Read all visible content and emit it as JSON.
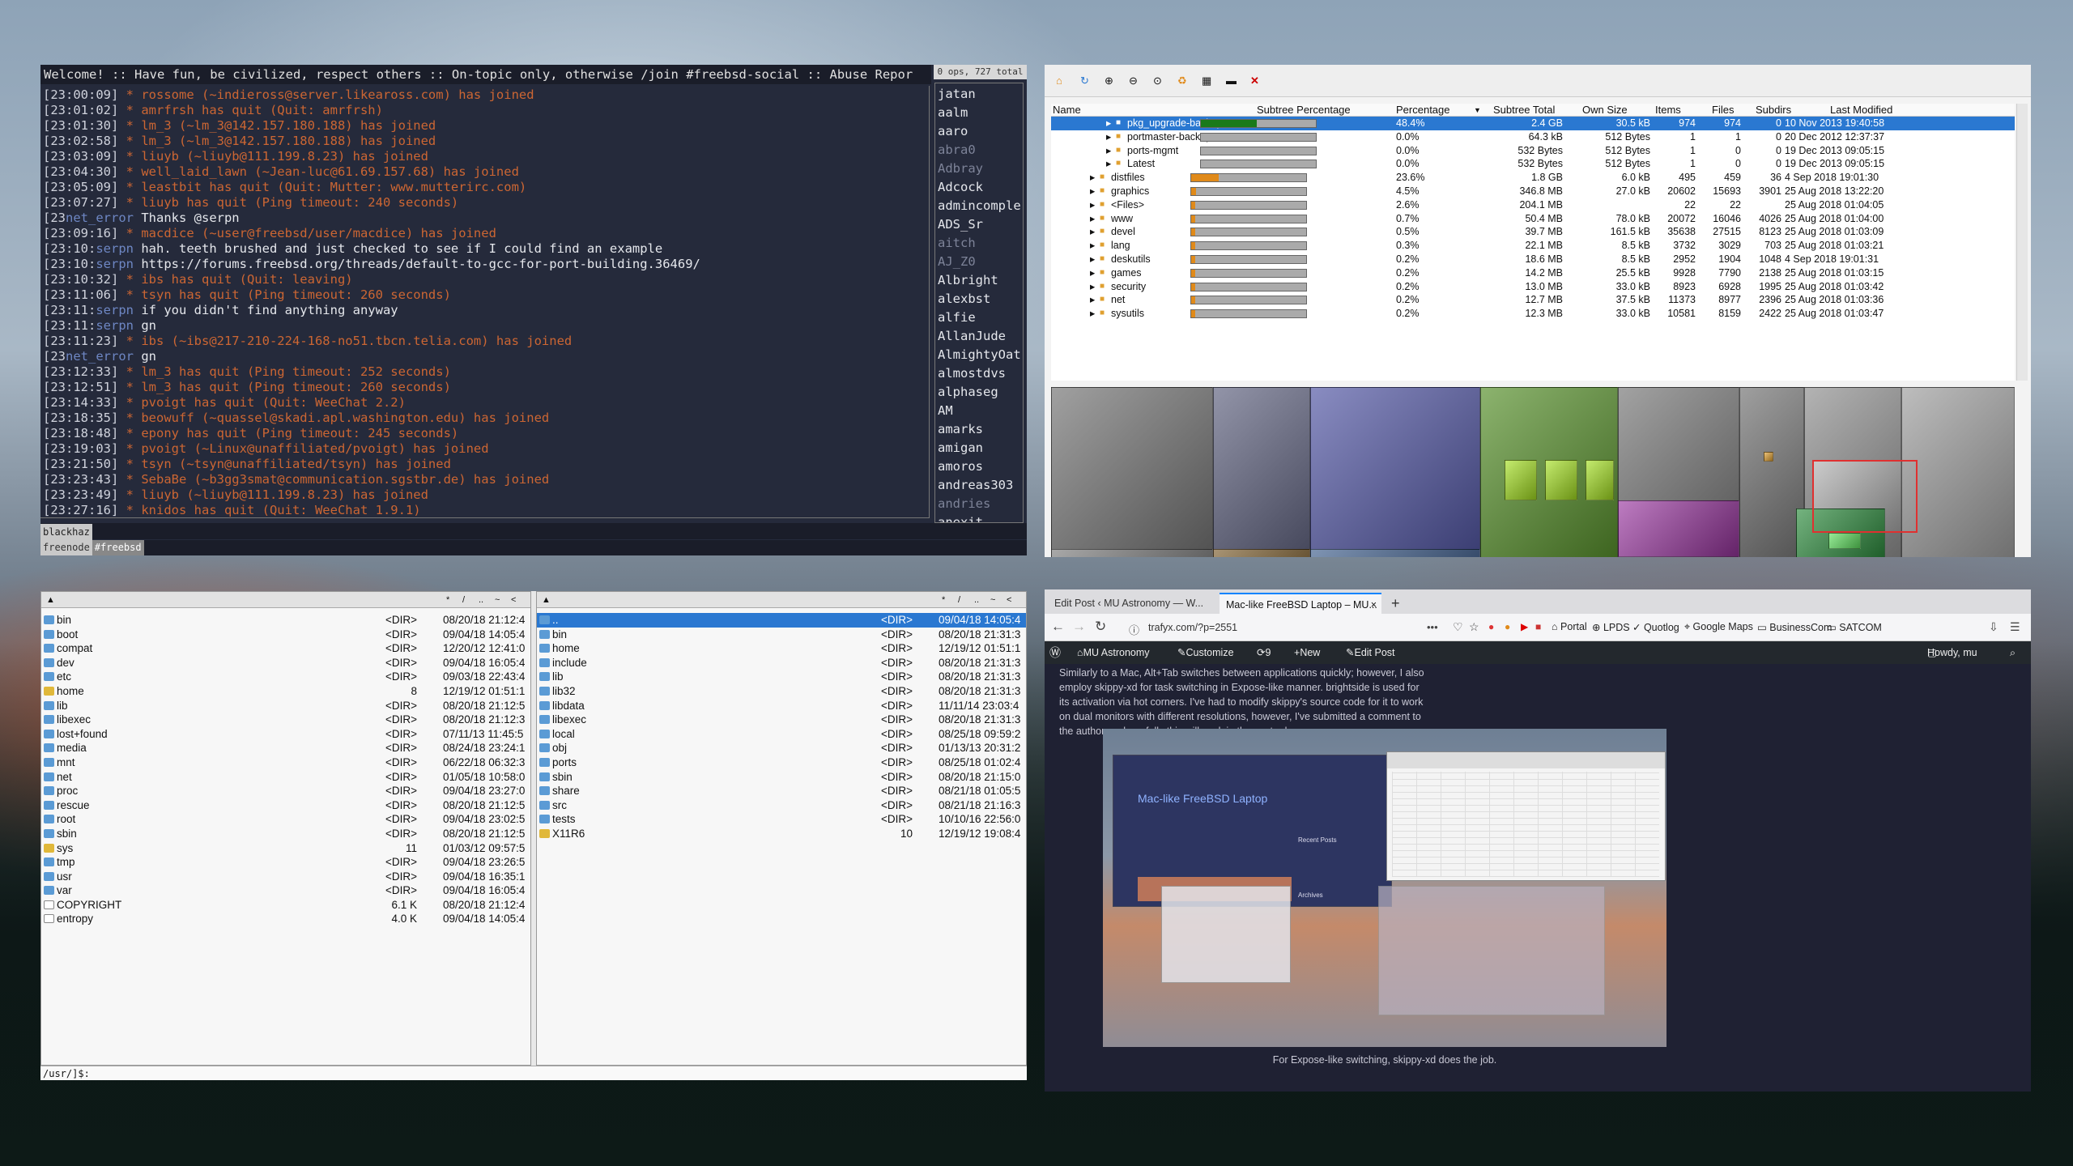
{
  "irc": {
    "topic": "Welcome! :: Have fun, be civilized, respect others :: On-topic only, otherwise /join #freebsd-social :: Abuse Repor",
    "ops_info": "0 ops, 727 total",
    "lines": [
      {
        "ts": "[23:00:09]",
        "sym": " * ",
        "text": "rossome (~indieross@server.likeaross.com) has joined",
        "kind": "ev"
      },
      {
        "ts": "[23:01:02]",
        "sym": " * ",
        "text": "amrfrsh has quit (Quit: amrfrsh)",
        "kind": "ev"
      },
      {
        "ts": "[23:01:30]",
        "sym": " * ",
        "text": "lm_3 (~lm_3@142.157.180.188) has joined",
        "kind": "ev"
      },
      {
        "ts": "[23:02:58]",
        "sym": " * ",
        "text": "lm_3  (~lm_3@142.157.180.188) has joined",
        "kind": "ev"
      },
      {
        "ts": "[23:03:09]",
        "sym": " * ",
        "text": "liuyb (~liuyb@111.199.8.23) has joined",
        "kind": "ev"
      },
      {
        "ts": "[23:04:30]",
        "sym": " * ",
        "text": "well_laid_lawn (~Jean-luc@61.69.157.68) has joined",
        "kind": "ev"
      },
      {
        "ts": "[23:05:09]",
        "sym": " * ",
        "text": "leastbit has quit (Quit: Mutter: www.mutterirc.com)",
        "kind": "ev"
      },
      {
        "ts": "[23:07:27]",
        "sym": " * ",
        "text": "liuyb has quit (Ping timeout: 240 seconds)",
        "kind": "ev"
      },
      {
        "ts": "[23",
        "sym": "net_error ",
        "text": "Thanks @serpn",
        "kind": "tx"
      },
      {
        "ts": "[23:09:16]",
        "sym": " * ",
        "text": "macdice (~user@freebsd/user/macdice) has joined",
        "kind": "ev"
      },
      {
        "ts": "[23:10:",
        "sym": "serpn ",
        "text": "hah. teeth brushed and just checked to see if I could find an example",
        "kind": "tx"
      },
      {
        "ts": "[23:10:",
        "sym": "serpn ",
        "text": "https://forums.freebsd.org/threads/default-to-gcc-for-port-building.36469/",
        "kind": "tx"
      },
      {
        "ts": "[23:10:32]",
        "sym": " * ",
        "text": "ibs has quit (Quit: leaving)",
        "kind": "ev"
      },
      {
        "ts": "[23:11:06]",
        "sym": " * ",
        "text": "tsyn has quit (Ping timeout: 260 seconds)",
        "kind": "ev"
      },
      {
        "ts": "[23:11:",
        "sym": "serpn ",
        "text": "if you didn't find anything anyway",
        "kind": "tx"
      },
      {
        "ts": "[23:11:",
        "sym": "serpn ",
        "text": "gn",
        "kind": "tx"
      },
      {
        "ts": "[23:11:23]",
        "sym": " * ",
        "text": "ibs (~ibs@217-210-224-168-no51.tbcn.telia.com) has joined",
        "kind": "ev"
      },
      {
        "ts": "[23",
        "sym": "net_error ",
        "text": "gn",
        "kind": "tx"
      },
      {
        "ts": "[23:12:33]",
        "sym": " * ",
        "text": "lm_3  has quit (Ping timeout: 252 seconds)",
        "kind": "ev"
      },
      {
        "ts": "[23:12:51]",
        "sym": " * ",
        "text": "lm_3 has quit (Ping timeout: 260 seconds)",
        "kind": "ev"
      },
      {
        "ts": "[23:14:33]",
        "sym": " * ",
        "text": "pvoigt has quit (Quit: WeeChat 2.2)",
        "kind": "ev"
      },
      {
        "ts": "[23:18:35]",
        "sym": " * ",
        "text": "beowuff (~quassel@skadi.apl.washington.edu) has joined",
        "kind": "ev"
      },
      {
        "ts": "[23:18:48]",
        "sym": " * ",
        "text": "epony has quit (Ping timeout: 245 seconds)",
        "kind": "ev"
      },
      {
        "ts": "[23:19:03]",
        "sym": " * ",
        "text": "pvoigt (~Linux@unaffiliated/pvoigt) has joined",
        "kind": "ev"
      },
      {
        "ts": "[23:21:50]",
        "sym": " * ",
        "text": "tsyn (~tsyn@unaffiliated/tsyn) has joined",
        "kind": "ev"
      },
      {
        "ts": "[23:23:43]",
        "sym": " * ",
        "text": "SebaBe (~b3gg3smat@communication.sgstbr.de) has joined",
        "kind": "ev"
      },
      {
        "ts": "[23:23:49]",
        "sym": " * ",
        "text": "liuyb (~liuyb@111.199.8.23) has joined",
        "kind": "ev"
      },
      {
        "ts": "[23:27:16]",
        "sym": " * ",
        "text": "knidos has quit (Quit: WeeChat 1.9.1)",
        "kind": "ev"
      }
    ],
    "nicks": [
      {
        "n": " jatan",
        "away": false
      },
      {
        "n": "aalm",
        "away": false
      },
      {
        "n": "aaro",
        "away": false
      },
      {
        "n": "abra0",
        "away": true
      },
      {
        "n": "Adbray",
        "away": true
      },
      {
        "n": "Adcock",
        "away": false
      },
      {
        "n": "admincomple",
        "away": false
      },
      {
        "n": "ADS_Sr",
        "away": false
      },
      {
        "n": "aitch",
        "away": true
      },
      {
        "n": "AJ_Z0",
        "away": true
      },
      {
        "n": "Albright",
        "away": false
      },
      {
        "n": "alexbst",
        "away": false
      },
      {
        "n": "alfie",
        "away": false
      },
      {
        "n": "AllanJude",
        "away": false
      },
      {
        "n": "AlmightyOat",
        "away": false
      },
      {
        "n": "almostdvs",
        "away": false
      },
      {
        "n": "alphaseg",
        "away": false
      },
      {
        "n": "AM",
        "away": false
      },
      {
        "n": "amarks",
        "away": false
      },
      {
        "n": "amigan",
        "away": false
      },
      {
        "n": "amoros",
        "away": false
      },
      {
        "n": "andreas303",
        "away": false
      },
      {
        "n": "andries",
        "away": true
      },
      {
        "n": "anexit",
        "away": false
      }
    ],
    "input_nick": "blackhaz",
    "status": [
      "freenode",
      "#freebsd"
    ]
  },
  "disk": {
    "toolbar_icons": [
      "home-icon",
      "refresh-icon",
      "zoom-in-icon",
      "zoom-out-icon",
      "zoom-fit-icon",
      "delete-icon",
      "grid-icon",
      "terminal-icon",
      "close-icon"
    ],
    "columns": [
      "Name",
      "Subtree Percentage",
      "Percentage",
      "Subtree Total",
      "Own Size",
      "Items",
      "Files",
      "Subdirs",
      "Last Modified"
    ],
    "rows": [
      {
        "indent": 3,
        "name": "pkg_upgrade-backup",
        "pct": "48.4%",
        "fill": 0.484,
        "color": "#1a7a1a",
        "total": "2.4 GB",
        "own": "30.5 kB",
        "items": "974",
        "files": "974",
        "subdirs": "0",
        "mod": "10 Nov 2013 19:40:58",
        "sel": true
      },
      {
        "indent": 3,
        "name": "portmaster-backup",
        "pct": "0.0%",
        "fill": 0.0,
        "color": "#1a7a1a",
        "total": "64.3 kB",
        "own": "512 Bytes",
        "items": "1",
        "files": "1",
        "subdirs": "0",
        "mod": "20 Dec 2012 12:37:37",
        "sel": false
      },
      {
        "indent": 3,
        "name": "ports-mgmt",
        "pct": "0.0%",
        "fill": 0.0,
        "color": "#1a7a1a",
        "total": "532 Bytes",
        "own": "512 Bytes",
        "items": "1",
        "files": "0",
        "subdirs": "0",
        "mod": "19 Dec 2013 09:05:15",
        "sel": false
      },
      {
        "indent": 3,
        "name": "Latest",
        "pct": "0.0%",
        "fill": 0.0,
        "color": "#1a7a1a",
        "total": "532 Bytes",
        "own": "512 Bytes",
        "items": "1",
        "files": "0",
        "subdirs": "0",
        "mod": "19 Dec 2013 09:05:15",
        "sel": false
      },
      {
        "indent": 2,
        "name": "distfiles",
        "pct": "23.6%",
        "fill": 0.236,
        "color": "#e08a1a",
        "total": "1.8 GB",
        "own": "6.0 kB",
        "items": "495",
        "files": "459",
        "subdirs": "36",
        "mod": "4 Sep 2018 19:01:30",
        "sel": false
      },
      {
        "indent": 2,
        "name": "graphics",
        "pct": "4.5%",
        "fill": 0.045,
        "color": "#e08a1a",
        "total": "346.8 MB",
        "own": "27.0 kB",
        "items": "20602",
        "files": "15693",
        "subdirs": "3901",
        "mod": "25 Aug 2018 13:22:20",
        "sel": false
      },
      {
        "indent": 2,
        "name": "<Files>",
        "pct": "2.6%",
        "fill": 0.026,
        "color": "#e08a1a",
        "total": "204.1 MB",
        "own": "",
        "items": "22",
        "files": "22",
        "subdirs": "",
        "mod": "25 Aug 2018 01:04:05",
        "sel": false
      },
      {
        "indent": 2,
        "name": "www",
        "pct": "0.7%",
        "fill": 0.007,
        "color": "#e08a1a",
        "total": "50.4 MB",
        "own": "78.0 kB",
        "items": "20072",
        "files": "16046",
        "subdirs": "4026",
        "mod": "25 Aug 2018 01:04:00",
        "sel": false
      },
      {
        "indent": 2,
        "name": "devel",
        "pct": "0.5%",
        "fill": 0.005,
        "color": "#e08a1a",
        "total": "39.7 MB",
        "own": "161.5 kB",
        "items": "35638",
        "files": "27515",
        "subdirs": "8123",
        "mod": "25 Aug 2018 01:03:09",
        "sel": false
      },
      {
        "indent": 2,
        "name": "lang",
        "pct": "0.3%",
        "fill": 0.003,
        "color": "#e08a1a",
        "total": "22.1 MB",
        "own": "8.5 kB",
        "items": "3732",
        "files": "3029",
        "subdirs": "703",
        "mod": "25 Aug 2018 01:03:21",
        "sel": false
      },
      {
        "indent": 2,
        "name": "deskutils",
        "pct": "0.2%",
        "fill": 0.002,
        "color": "#e08a1a",
        "total": "18.6 MB",
        "own": "8.5 kB",
        "items": "2952",
        "files": "1904",
        "subdirs": "1048",
        "mod": "4 Sep 2018 19:01:31",
        "sel": false
      },
      {
        "indent": 2,
        "name": "games",
        "pct": "0.2%",
        "fill": 0.002,
        "color": "#e08a1a",
        "total": "14.2 MB",
        "own": "25.5 kB",
        "items": "9928",
        "files": "7790",
        "subdirs": "2138",
        "mod": "25 Aug 2018 01:03:15",
        "sel": false
      },
      {
        "indent": 2,
        "name": "security",
        "pct": "0.2%",
        "fill": 0.002,
        "color": "#e08a1a",
        "total": "13.0 MB",
        "own": "33.0 kB",
        "items": "8923",
        "files": "6928",
        "subdirs": "1995",
        "mod": "25 Aug 2018 01:03:42",
        "sel": false
      },
      {
        "indent": 2,
        "name": "net",
        "pct": "0.2%",
        "fill": 0.002,
        "color": "#e08a1a",
        "total": "12.7 MB",
        "own": "37.5 kB",
        "items": "11373",
        "files": "8977",
        "subdirs": "2396",
        "mod": "25 Aug 2018 01:03:36",
        "sel": false
      },
      {
        "indent": 2,
        "name": "sysutils",
        "pct": "0.2%",
        "fill": 0.002,
        "color": "#e08a1a",
        "total": "12.3 MB",
        "own": "33.0 kB",
        "items": "10581",
        "files": "8159",
        "subdirs": "2422",
        "mod": "25 Aug 2018 01:03:47",
        "sel": false
      }
    ]
  },
  "fm": {
    "left_header": [
      "▲",
      "*",
      "/",
      "..",
      "~",
      "<"
    ],
    "right_header": [
      "▲",
      "*",
      "/",
      "..",
      "~",
      "<"
    ],
    "left": [
      {
        "n": "bin",
        "s": "<DIR>",
        "d": "08/20/18 21:12:4",
        "t": "d"
      },
      {
        "n": "boot",
        "s": "<DIR>",
        "d": "09/04/18 14:05:4",
        "t": "d"
      },
      {
        "n": "compat",
        "s": "<DIR>",
        "d": "12/20/12 12:41:0",
        "t": "d"
      },
      {
        "n": "dev",
        "s": "<DIR>",
        "d": "09/04/18 16:05:4",
        "t": "d"
      },
      {
        "n": "etc",
        "s": "<DIR>",
        "d": "09/03/18 22:43:4",
        "t": "d"
      },
      {
        "n": "home",
        "s": "8",
        "d": "12/19/12 01:51:1",
        "t": "y"
      },
      {
        "n": "lib",
        "s": "<DIR>",
        "d": "08/20/18 21:12:5",
        "t": "d"
      },
      {
        "n": "libexec",
        "s": "<DIR>",
        "d": "08/20/18 21:12:3",
        "t": "d"
      },
      {
        "n": "lost+found",
        "s": "<DIR>",
        "d": "07/11/13 11:45:5",
        "t": "d"
      },
      {
        "n": "media",
        "s": "<DIR>",
        "d": "08/24/18 23:24:1",
        "t": "d"
      },
      {
        "n": "mnt",
        "s": "<DIR>",
        "d": "06/22/18 06:32:3",
        "t": "d"
      },
      {
        "n": "net",
        "s": "<DIR>",
        "d": "01/05/18 10:58:0",
        "t": "d"
      },
      {
        "n": "proc",
        "s": "<DIR>",
        "d": "09/04/18 23:27:0",
        "t": "d"
      },
      {
        "n": "rescue",
        "s": "<DIR>",
        "d": "08/20/18 21:12:5",
        "t": "d"
      },
      {
        "n": "root",
        "s": "<DIR>",
        "d": "09/04/18 23:02:5",
        "t": "d"
      },
      {
        "n": "sbin",
        "s": "<DIR>",
        "d": "08/20/18 21:12:5",
        "t": "d"
      },
      {
        "n": "sys",
        "s": "11",
        "d": "01/03/12 09:57:5",
        "t": "y"
      },
      {
        "n": "tmp",
        "s": "<DIR>",
        "d": "09/04/18 23:26:5",
        "t": "d"
      },
      {
        "n": "usr",
        "s": "<DIR>",
        "d": "09/04/18 16:35:1",
        "t": "d"
      },
      {
        "n": "var",
        "s": "<DIR>",
        "d": "09/04/18 16:05:4",
        "t": "d"
      },
      {
        "n": "COPYRIGHT",
        "s": "6.1 K",
        "d": "08/20/18 21:12:4",
        "t": "f"
      },
      {
        "n": "entropy",
        "s": "4.0 K",
        "d": "09/04/18 14:05:4",
        "t": "f"
      }
    ],
    "right": [
      {
        "n": "..",
        "s": "<DIR>",
        "d": "09/04/18 14:05:4",
        "t": "d",
        "sel": true
      },
      {
        "n": "bin",
        "s": "<DIR>",
        "d": "08/20/18 21:31:3",
        "t": "d"
      },
      {
        "n": "home",
        "s": "<DIR>",
        "d": "12/19/12 01:51:1",
        "t": "d"
      },
      {
        "n": "include",
        "s": "<DIR>",
        "d": "08/20/18 21:31:3",
        "t": "d"
      },
      {
        "n": "lib",
        "s": "<DIR>",
        "d": "08/20/18 21:31:3",
        "t": "d"
      },
      {
        "n": "lib32",
        "s": "<DIR>",
        "d": "08/20/18 21:31:3",
        "t": "d"
      },
      {
        "n": "libdata",
        "s": "<DIR>",
        "d": "11/11/14 23:03:4",
        "t": "d"
      },
      {
        "n": "libexec",
        "s": "<DIR>",
        "d": "08/20/18 21:31:3",
        "t": "d"
      },
      {
        "n": "local",
        "s": "<DIR>",
        "d": "08/25/18 09:59:2",
        "t": "d"
      },
      {
        "n": "obj",
        "s": "<DIR>",
        "d": "01/13/13 20:31:2",
        "t": "d"
      },
      {
        "n": "ports",
        "s": "<DIR>",
        "d": "08/25/18 01:02:4",
        "t": "d"
      },
      {
        "n": "sbin",
        "s": "<DIR>",
        "d": "08/20/18 21:15:0",
        "t": "d"
      },
      {
        "n": "share",
        "s": "<DIR>",
        "d": "08/21/18 01:05:5",
        "t": "d"
      },
      {
        "n": "src",
        "s": "<DIR>",
        "d": "08/21/18 21:16:3",
        "t": "d"
      },
      {
        "n": "tests",
        "s": "<DIR>",
        "d": "10/10/16 22:56:0",
        "t": "d"
      },
      {
        "n": "X11R6",
        "s": "10",
        "d": "12/19/12 19:08:4",
        "t": "y"
      }
    ],
    "cmdline": "/usr/]$:"
  },
  "browser": {
    "tabs": [
      "Edit Post ‹ MU Astronomy — W...",
      "Mac-like FreeBSD Laptop – MU..."
    ],
    "tab_close": "×",
    "new_tab": "+",
    "url": "trafyx.com/?p=2551",
    "url_more": "•••",
    "bookmarks": [
      "Portal",
      "LPDS",
      "Quotlog",
      "Google Maps",
      "BusinessCom",
      "SATCOM"
    ],
    "wp": {
      "site": "MU Astronomy",
      "customize": "Customize",
      "updates": "9",
      "new": "New",
      "edit": "Edit Post",
      "howdy": "Howdy, mu"
    },
    "paragraph": "Similarly to a Mac, Alt+Tab switches between applications quickly; however, I also employ skippy-xd for task switching in Expose-like manner. brightside is used for its activation via hot corners. I've had to modify skippy's source code for it to work on dual monitors with different resolutions, however, I've submitted a comment to the author, so hopefully this will work in the next release.",
    "inner_title": "Mac-like FreeBSD Laptop",
    "inner_recent": "Recent Posts",
    "inner_archives": "Archives",
    "caption": "For Expose-like switching, skippy-xd does the job."
  }
}
